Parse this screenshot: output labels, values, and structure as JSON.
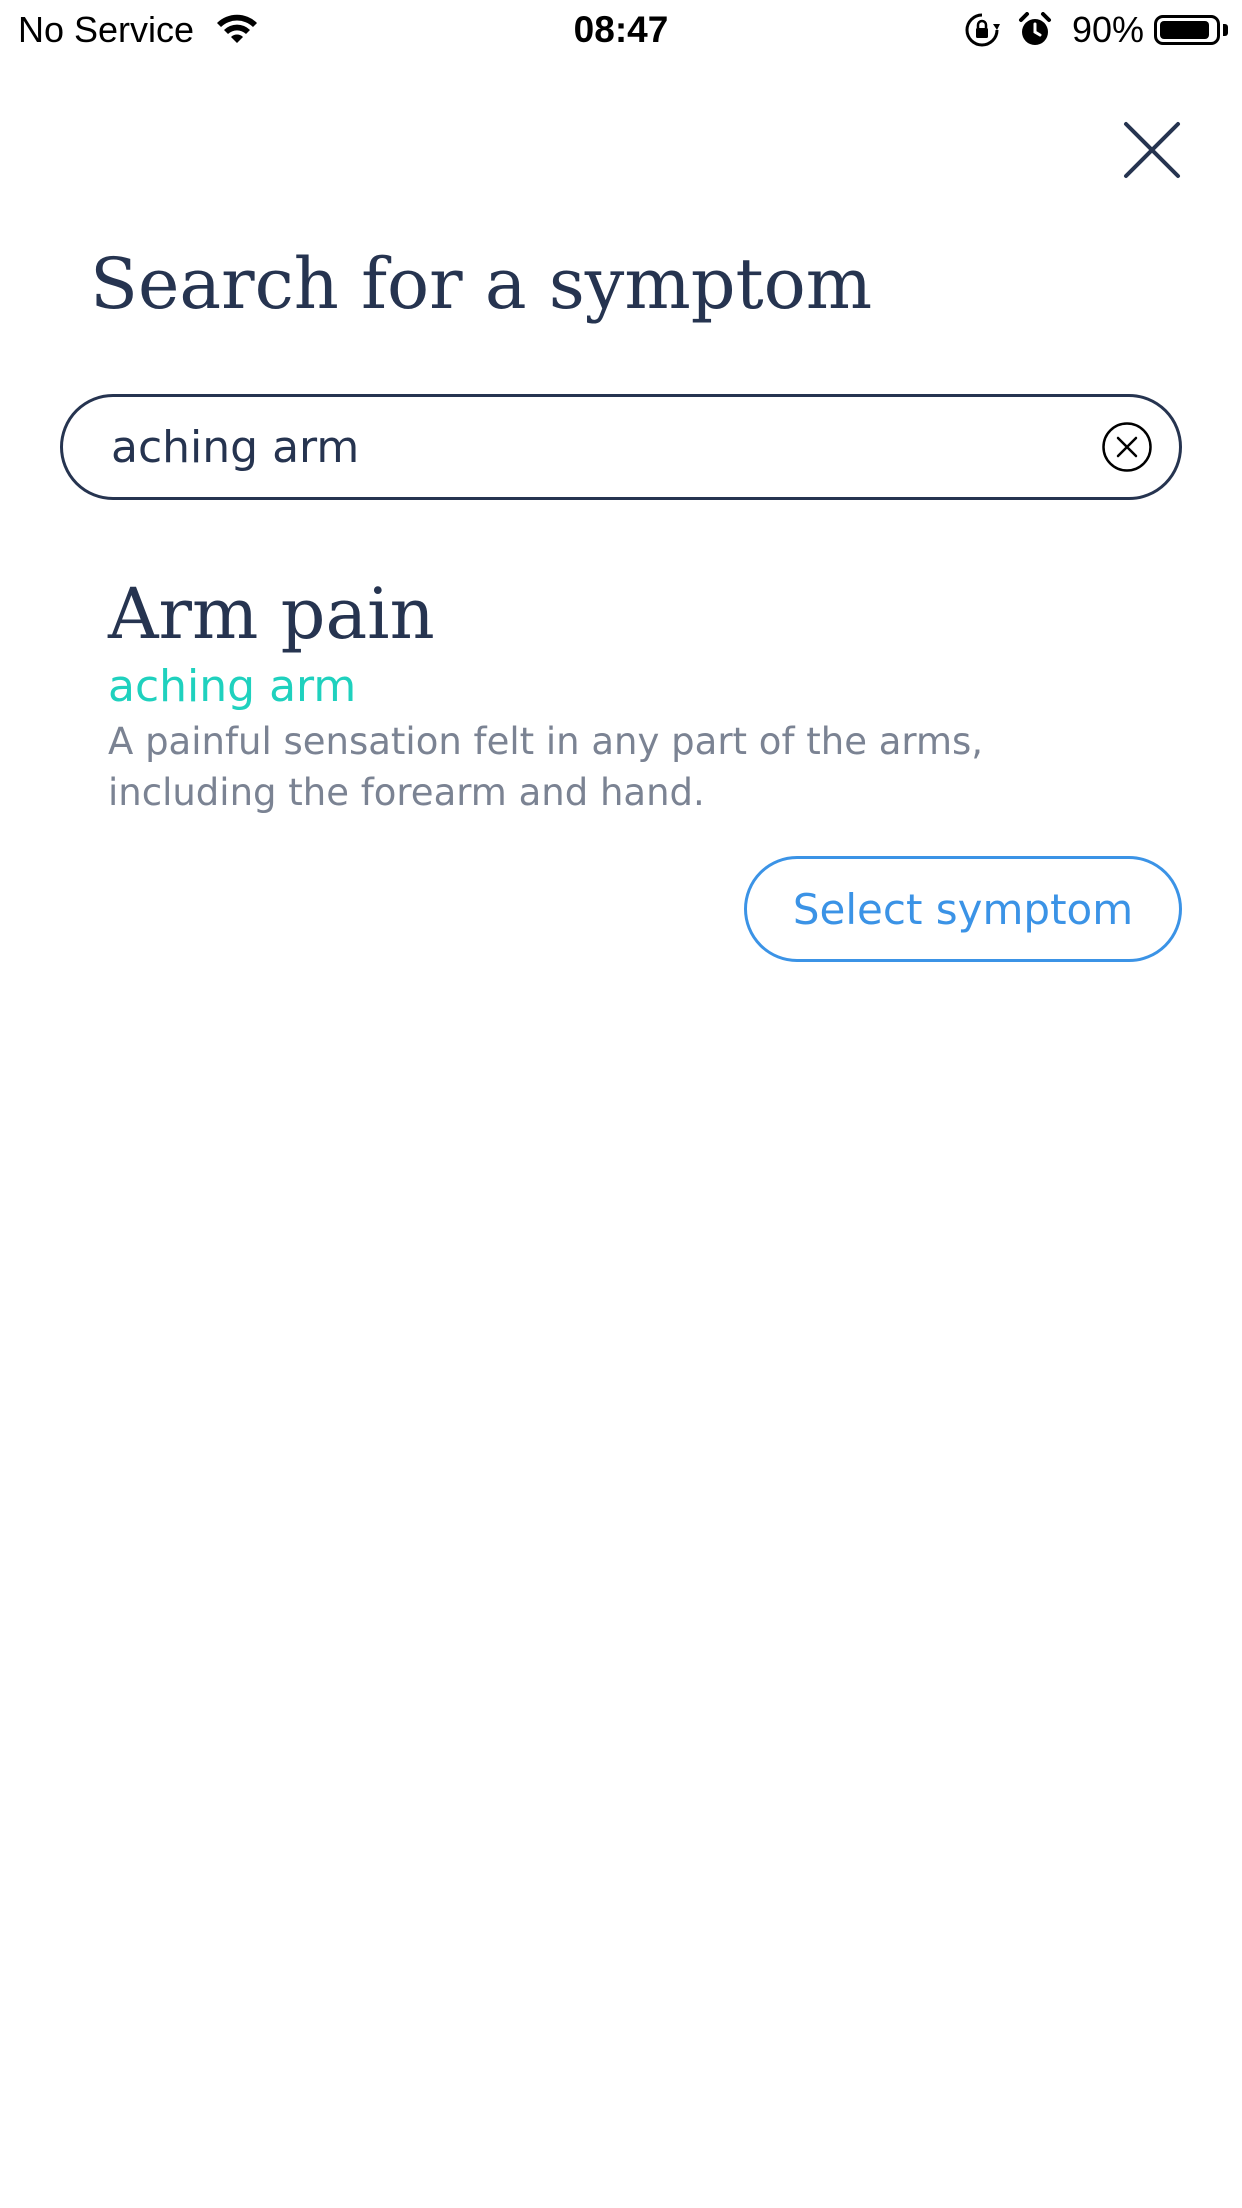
{
  "status_bar": {
    "carrier": "No Service",
    "time": "08:47",
    "battery_percent": "90%",
    "battery_level": 0.9,
    "icons": [
      "wifi-icon",
      "rotation-lock-icon",
      "alarm-icon",
      "battery-icon"
    ]
  },
  "header": {
    "close_icon": "close-icon",
    "title": "Search for a symptom"
  },
  "search": {
    "value": "aching arm",
    "clear_icon": "clear-circle-icon"
  },
  "result": {
    "name": "Arm pain",
    "match": "aching arm",
    "description": "A painful sensation felt in any part of the arms, including the forearm and hand.",
    "button_label": "Select symptom"
  },
  "colors": {
    "text_dark": "#263450",
    "accent_teal": "#1fd1be",
    "description_gray": "#7b8393",
    "button_blue": "#3b93e6"
  }
}
